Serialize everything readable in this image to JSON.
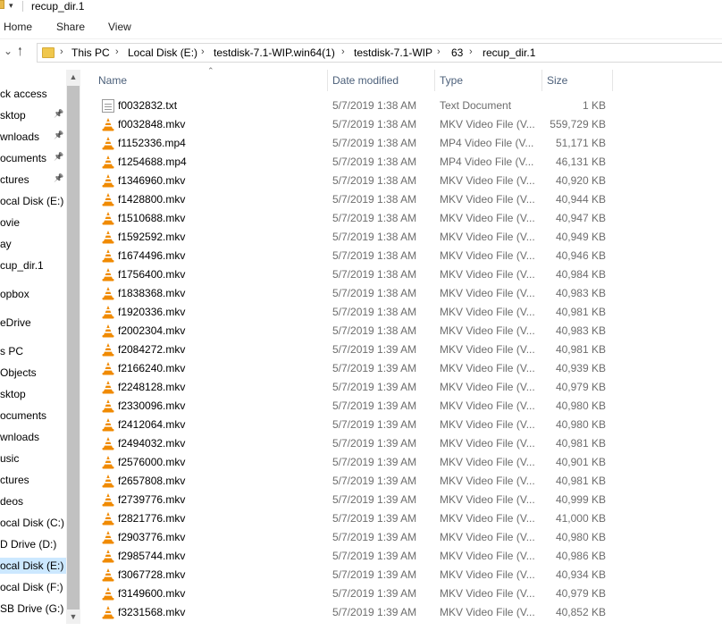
{
  "window": {
    "title": "recup_dir.1"
  },
  "ribbon": {
    "tabs": [
      "Home",
      "Share",
      "View"
    ]
  },
  "address": {
    "crumbs": [
      "This PC",
      "Local Disk (E:)",
      "testdisk-7.1-WIP.win64(1)",
      "testdisk-7.1-WIP",
      "63",
      "recup_dir.1"
    ]
  },
  "nav": {
    "items": [
      {
        "label": "ck access",
        "pinned": false
      },
      {
        "label": "sktop",
        "pinned": true
      },
      {
        "label": "wnloads",
        "pinned": true
      },
      {
        "label": "ocuments",
        "pinned": true
      },
      {
        "label": "ctures",
        "pinned": true
      },
      {
        "label": "ocal Disk (E:)",
        "pinned": false
      },
      {
        "label": "ovie",
        "pinned": false
      },
      {
        "label": "ay",
        "pinned": false
      },
      {
        "label": "cup_dir.1",
        "pinned": false
      },
      {
        "label": "opbox",
        "pinned": false,
        "gap": true
      },
      {
        "label": "eDrive",
        "pinned": false,
        "gap": true
      },
      {
        "label": "s PC",
        "pinned": false,
        "gap": true
      },
      {
        "label": "Objects",
        "pinned": false
      },
      {
        "label": "sktop",
        "pinned": false
      },
      {
        "label": "ocuments",
        "pinned": false
      },
      {
        "label": "wnloads",
        "pinned": false
      },
      {
        "label": "usic",
        "pinned": false
      },
      {
        "label": "ctures",
        "pinned": false
      },
      {
        "label": "deos",
        "pinned": false
      },
      {
        "label": "ocal Disk (C:)",
        "pinned": false
      },
      {
        "label": "D Drive (D:)",
        "pinned": false
      },
      {
        "label": "ocal Disk (E:)",
        "pinned": false,
        "selected": true
      },
      {
        "label": "ocal Disk (F:)",
        "pinned": false
      },
      {
        "label": "SB Drive (G:)",
        "pinned": false
      }
    ]
  },
  "columns": {
    "name": "Name",
    "date": "Date modified",
    "type": "Type",
    "size": "Size"
  },
  "files": [
    {
      "name": "f0032832.txt",
      "date": "5/7/2019 1:38 AM",
      "type": "Text Document",
      "size": "1 KB",
      "kind": "txt"
    },
    {
      "name": "f0032848.mkv",
      "date": "5/7/2019 1:38 AM",
      "type": "MKV Video File (V...",
      "size": "559,729 KB",
      "kind": "vlc"
    },
    {
      "name": "f1152336.mp4",
      "date": "5/7/2019 1:38 AM",
      "type": "MP4 Video File (V...",
      "size": "51,171 KB",
      "kind": "vlc"
    },
    {
      "name": "f1254688.mp4",
      "date": "5/7/2019 1:38 AM",
      "type": "MP4 Video File (V...",
      "size": "46,131 KB",
      "kind": "vlc"
    },
    {
      "name": "f1346960.mkv",
      "date": "5/7/2019 1:38 AM",
      "type": "MKV Video File (V...",
      "size": "40,920 KB",
      "kind": "vlc"
    },
    {
      "name": "f1428800.mkv",
      "date": "5/7/2019 1:38 AM",
      "type": "MKV Video File (V...",
      "size": "40,944 KB",
      "kind": "vlc"
    },
    {
      "name": "f1510688.mkv",
      "date": "5/7/2019 1:38 AM",
      "type": "MKV Video File (V...",
      "size": "40,947 KB",
      "kind": "vlc"
    },
    {
      "name": "f1592592.mkv",
      "date": "5/7/2019 1:38 AM",
      "type": "MKV Video File (V...",
      "size": "40,949 KB",
      "kind": "vlc"
    },
    {
      "name": "f1674496.mkv",
      "date": "5/7/2019 1:38 AM",
      "type": "MKV Video File (V...",
      "size": "40,946 KB",
      "kind": "vlc"
    },
    {
      "name": "f1756400.mkv",
      "date": "5/7/2019 1:38 AM",
      "type": "MKV Video File (V...",
      "size": "40,984 KB",
      "kind": "vlc"
    },
    {
      "name": "f1838368.mkv",
      "date": "5/7/2019 1:38 AM",
      "type": "MKV Video File (V...",
      "size": "40,983 KB",
      "kind": "vlc"
    },
    {
      "name": "f1920336.mkv",
      "date": "5/7/2019 1:38 AM",
      "type": "MKV Video File (V...",
      "size": "40,981 KB",
      "kind": "vlc"
    },
    {
      "name": "f2002304.mkv",
      "date": "5/7/2019 1:38 AM",
      "type": "MKV Video File (V...",
      "size": "40,983 KB",
      "kind": "vlc"
    },
    {
      "name": "f2084272.mkv",
      "date": "5/7/2019 1:39 AM",
      "type": "MKV Video File (V...",
      "size": "40,981 KB",
      "kind": "vlc"
    },
    {
      "name": "f2166240.mkv",
      "date": "5/7/2019 1:39 AM",
      "type": "MKV Video File (V...",
      "size": "40,939 KB",
      "kind": "vlc"
    },
    {
      "name": "f2248128.mkv",
      "date": "5/7/2019 1:39 AM",
      "type": "MKV Video File (V...",
      "size": "40,979 KB",
      "kind": "vlc"
    },
    {
      "name": "f2330096.mkv",
      "date": "5/7/2019 1:39 AM",
      "type": "MKV Video File (V...",
      "size": "40,980 KB",
      "kind": "vlc"
    },
    {
      "name": "f2412064.mkv",
      "date": "5/7/2019 1:39 AM",
      "type": "MKV Video File (V...",
      "size": "40,980 KB",
      "kind": "vlc"
    },
    {
      "name": "f2494032.mkv",
      "date": "5/7/2019 1:39 AM",
      "type": "MKV Video File (V...",
      "size": "40,981 KB",
      "kind": "vlc"
    },
    {
      "name": "f2576000.mkv",
      "date": "5/7/2019 1:39 AM",
      "type": "MKV Video File (V...",
      "size": "40,901 KB",
      "kind": "vlc"
    },
    {
      "name": "f2657808.mkv",
      "date": "5/7/2019 1:39 AM",
      "type": "MKV Video File (V...",
      "size": "40,981 KB",
      "kind": "vlc"
    },
    {
      "name": "f2739776.mkv",
      "date": "5/7/2019 1:39 AM",
      "type": "MKV Video File (V...",
      "size": "40,999 KB",
      "kind": "vlc"
    },
    {
      "name": "f2821776.mkv",
      "date": "5/7/2019 1:39 AM",
      "type": "MKV Video File (V...",
      "size": "41,000 KB",
      "kind": "vlc"
    },
    {
      "name": "f2903776.mkv",
      "date": "5/7/2019 1:39 AM",
      "type": "MKV Video File (V...",
      "size": "40,980 KB",
      "kind": "vlc"
    },
    {
      "name": "f2985744.mkv",
      "date": "5/7/2019 1:39 AM",
      "type": "MKV Video File (V...",
      "size": "40,986 KB",
      "kind": "vlc"
    },
    {
      "name": "f3067728.mkv",
      "date": "5/7/2019 1:39 AM",
      "type": "MKV Video File (V...",
      "size": "40,934 KB",
      "kind": "vlc"
    },
    {
      "name": "f3149600.mkv",
      "date": "5/7/2019 1:39 AM",
      "type": "MKV Video File (V...",
      "size": "40,979 KB",
      "kind": "vlc"
    },
    {
      "name": "f3231568.mkv",
      "date": "5/7/2019 1:39 AM",
      "type": "MKV Video File (V...",
      "size": "40,852 KB",
      "kind": "vlc"
    }
  ],
  "colors": {
    "selected": "#cce8ff",
    "header_text": "#4c607a",
    "meta_text": "#6d6d6d",
    "vlc_orange": "#f08a00"
  }
}
